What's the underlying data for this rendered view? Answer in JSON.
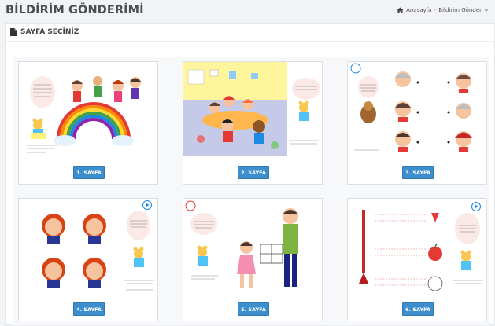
{
  "header": {
    "title": "BİLDİRİM GÖNDERİMİ",
    "breadcrumb": {
      "home": "Anasayfa",
      "current": "Bildirim Gönder"
    }
  },
  "panel": {
    "title": "SAYFA SEÇİNİZ"
  },
  "cards": [
    {
      "label": "1. SAYFA"
    },
    {
      "label": "2. SAYFA"
    },
    {
      "label": "3. SAYFA"
    },
    {
      "label": "4. SAYFA"
    },
    {
      "label": "5. SAYFA"
    },
    {
      "label": "6. SAYFA"
    }
  ],
  "colors": {
    "accent": "#3d8ecc",
    "title": "#4a4f55"
  }
}
